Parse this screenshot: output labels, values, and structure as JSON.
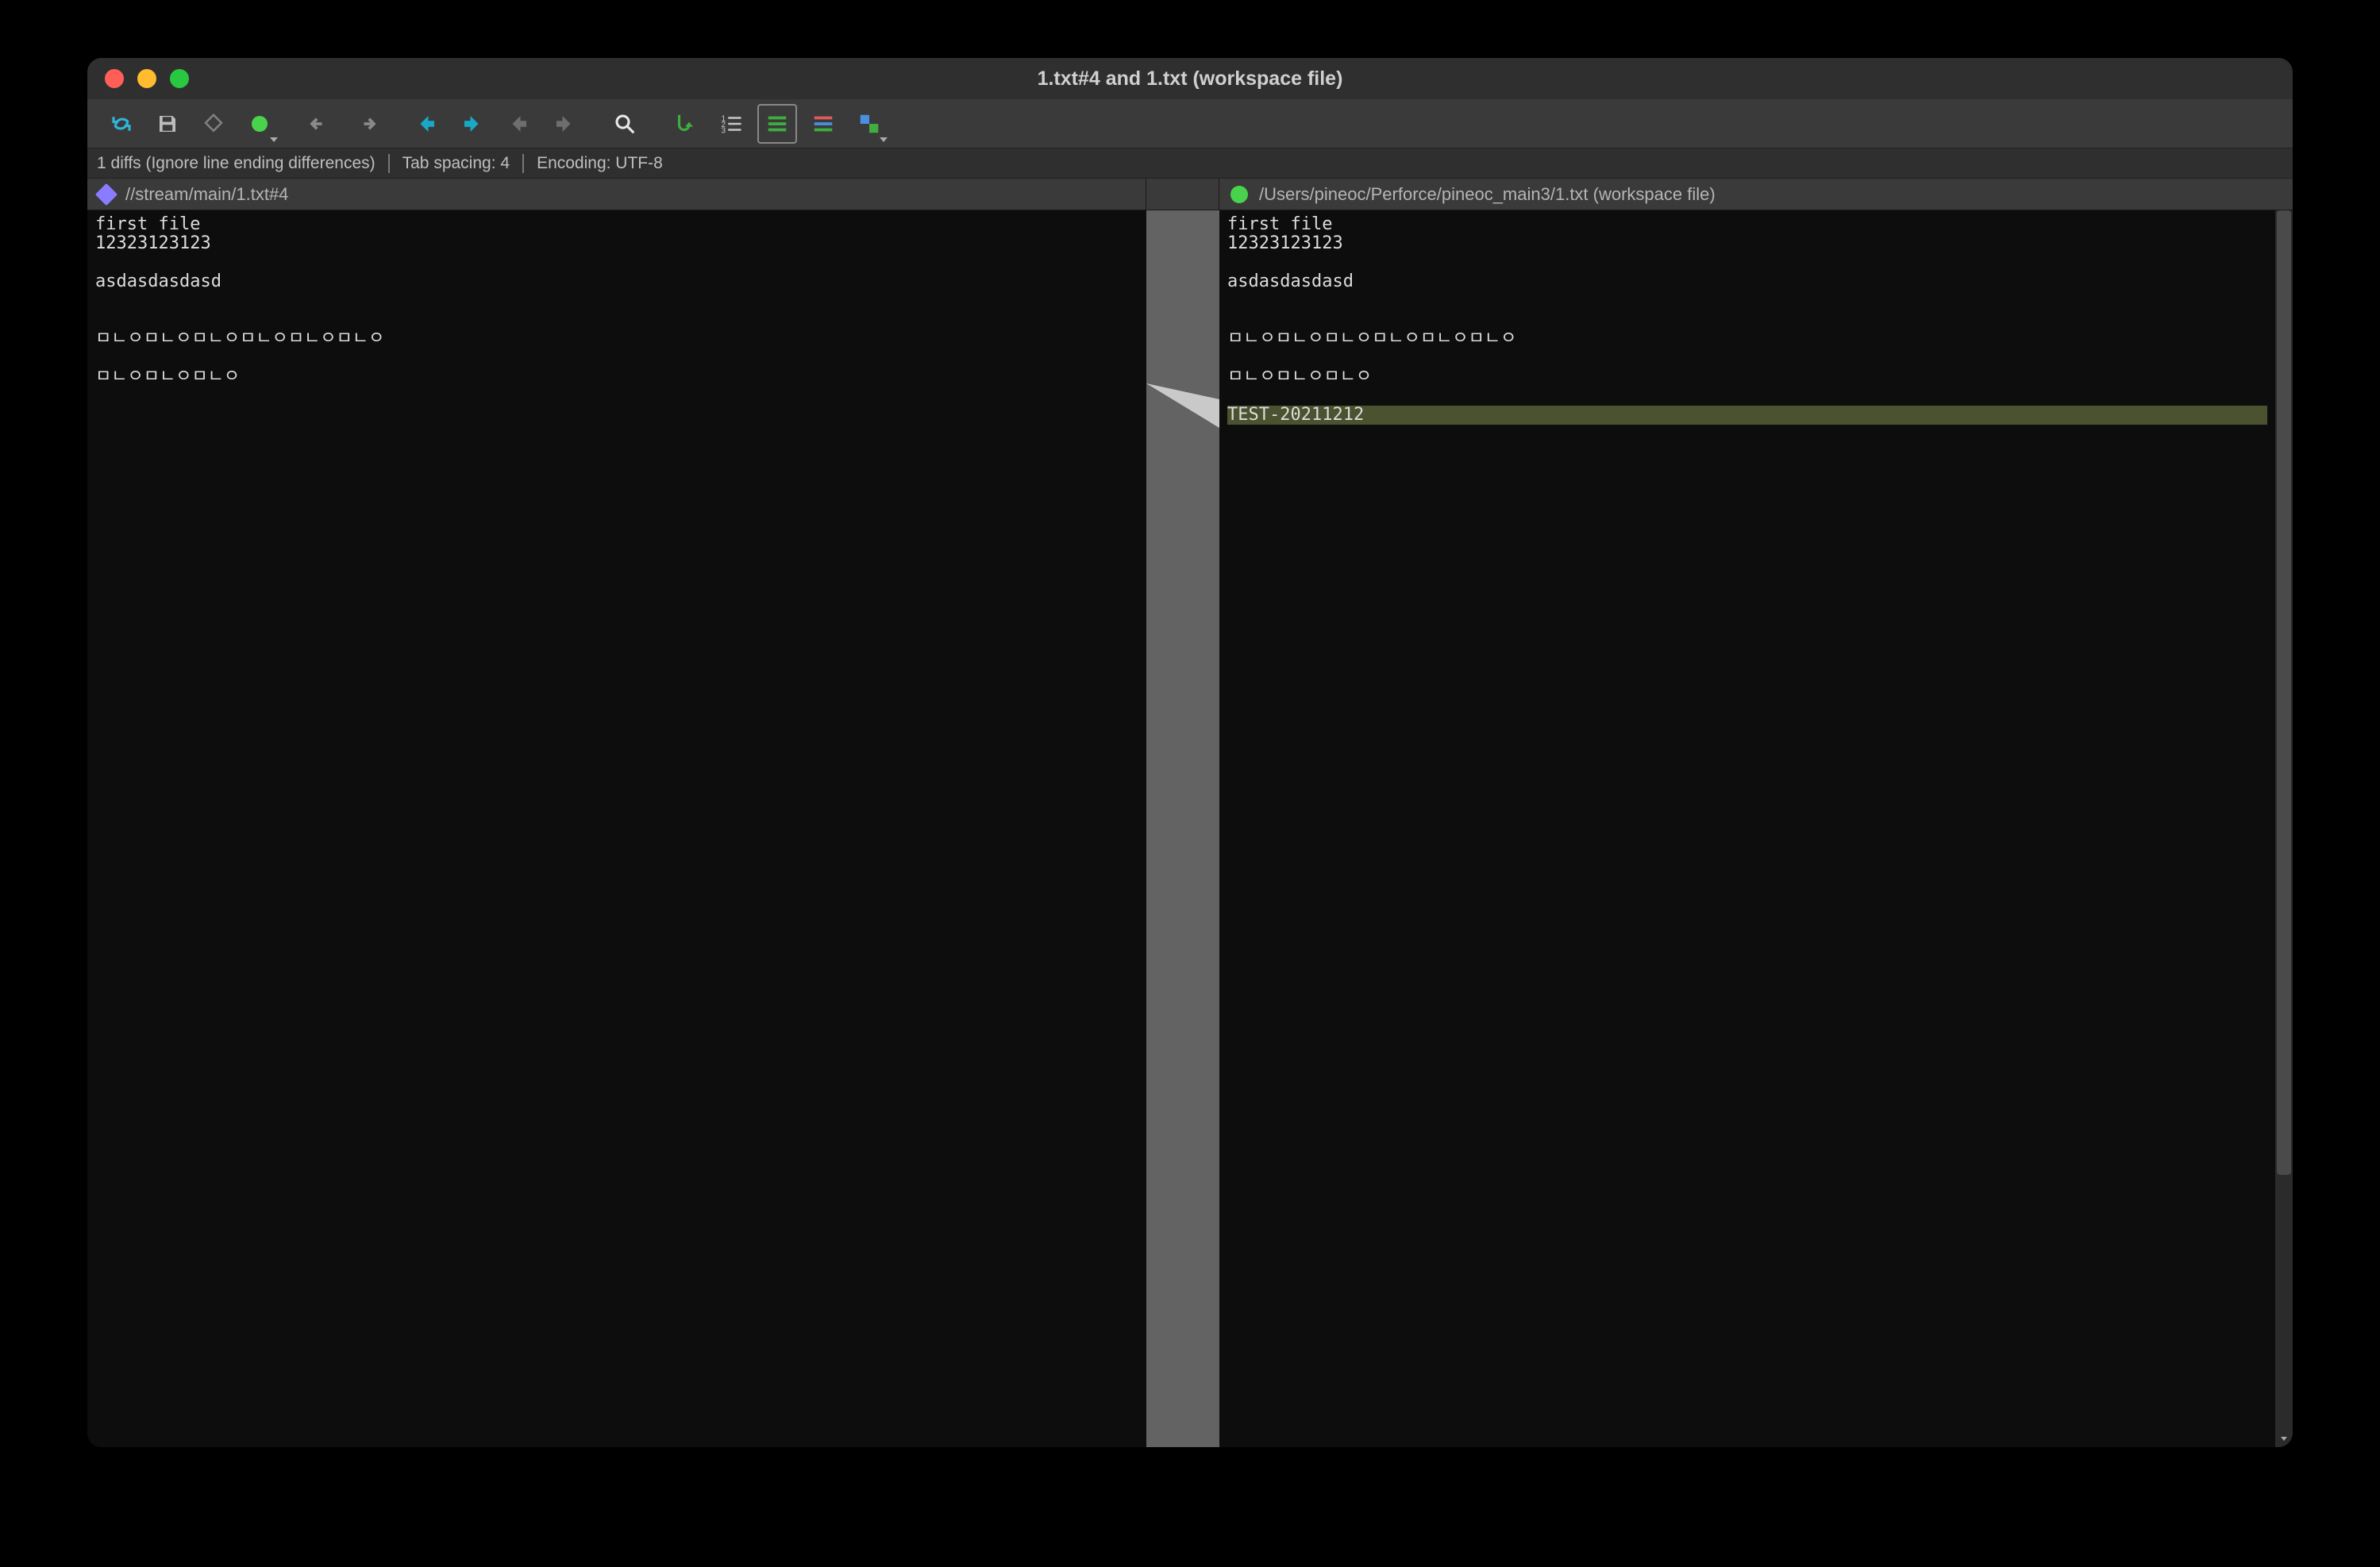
{
  "window": {
    "title": "1.txt#4 and 1.txt (workspace file)"
  },
  "toolbar": {
    "refresh": "Refresh",
    "save": "Save",
    "diff": "Diff",
    "green_dot": "Status",
    "undo": "Undo",
    "redo": "Redo",
    "prev_cyan": "Previous Diff",
    "next_cyan": "Next Diff",
    "prev_gray": "Previous",
    "next_gray": "Next",
    "search": "Find",
    "goto": "Go To",
    "line_numbers": "Line Numbers",
    "inline": "Inline Diff",
    "syntax": "Syntax Highlighting",
    "compare": "Compare Options"
  },
  "status": {
    "diffs": "1 diffs (Ignore line ending differences)",
    "tab": "Tab spacing: 4",
    "encoding": "Encoding: UTF-8"
  },
  "headers": {
    "left": "//stream/main/1.txt#4",
    "right": "/Users/pineoc/Perforce/pineoc_main3/1.txt (workspace file)"
  },
  "left_lines": [
    "first file",
    "12323123123",
    "",
    "asdasdasdasd",
    "",
    "",
    "ㅁㄴㅇㅁㄴㅇㅁㄴㅇㅁㄴㅇㅁㄴㅇㅁㄴㅇ",
    "",
    "ㅁㄴㅇㅁㄴㅇㅁㄴㅇ"
  ],
  "right_lines": [
    "first file",
    "12323123123",
    "",
    "asdasdasdasd",
    "",
    "",
    "ㅁㄴㅇㅁㄴㅇㅁㄴㅇㅁㄴㅇㅁㄴㅇㅁㄴㅇ",
    "",
    "ㅁㄴㅇㅁㄴㅇㅁㄴㅇ"
  ],
  "right_added": {
    "index": 9,
    "text": "TEST-20211212"
  }
}
